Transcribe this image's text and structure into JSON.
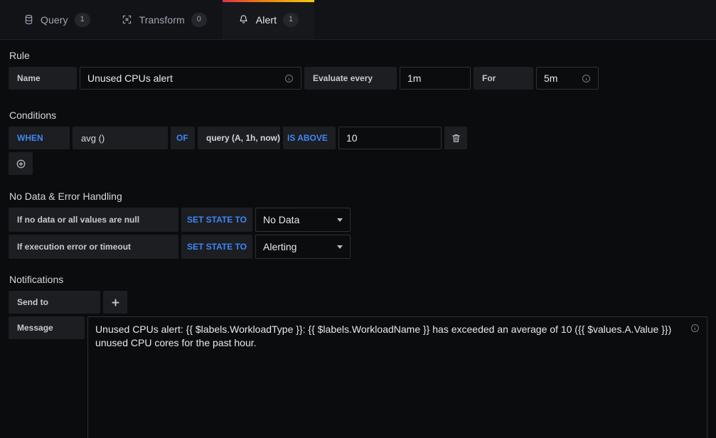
{
  "tabs": [
    {
      "label": "Query",
      "count": "1",
      "icon": "database-icon",
      "active": false
    },
    {
      "label": "Transform",
      "count": "0",
      "icon": "transform-icon",
      "active": false
    },
    {
      "label": "Alert",
      "count": "1",
      "icon": "bell-icon",
      "active": true
    }
  ],
  "rule": {
    "title": "Rule",
    "name_label": "Name",
    "name_value": "Unused CPUs alert",
    "evaluate_every_label": "Evaluate every",
    "evaluate_every_value": "1m",
    "for_label": "For",
    "for_value": "5m"
  },
  "conditions": {
    "title": "Conditions",
    "rows": [
      {
        "when": "WHEN",
        "func": "avg ()",
        "of": "OF",
        "query": "query (A, 1h, now)",
        "evaluator": "IS ABOVE",
        "value": "10"
      }
    ],
    "delete_icon": "trash-icon",
    "add_icon": "circle-plus-icon"
  },
  "no_data": {
    "title": "No Data & Error Handling",
    "rows": [
      {
        "label": "If no data or all values are null",
        "set_state_to": "SET STATE TO",
        "state": "No Data"
      },
      {
        "label": "If execution error or timeout",
        "set_state_to": "SET STATE TO",
        "state": "Alerting"
      }
    ]
  },
  "notifications": {
    "title": "Notifications",
    "send_to_label": "Send to",
    "add_icon": "plus-icon",
    "message_label": "Message",
    "message_value": "Unused CPUs alert: {{ $labels.WorkloadType }}: {{ $labels.WorkloadName }} has exceeded an average of 10 ({{ $values.A.Value }}) unused CPU cores for the past hour."
  },
  "colors": {
    "accent_blue": "#3d87f5",
    "tab_gradient_start": "#e02f44",
    "tab_gradient_mid": "#eb7b18",
    "tab_gradient_end": "#f2cc0c",
    "background": "#0b0c0e",
    "panel": "#1c1e22"
  }
}
